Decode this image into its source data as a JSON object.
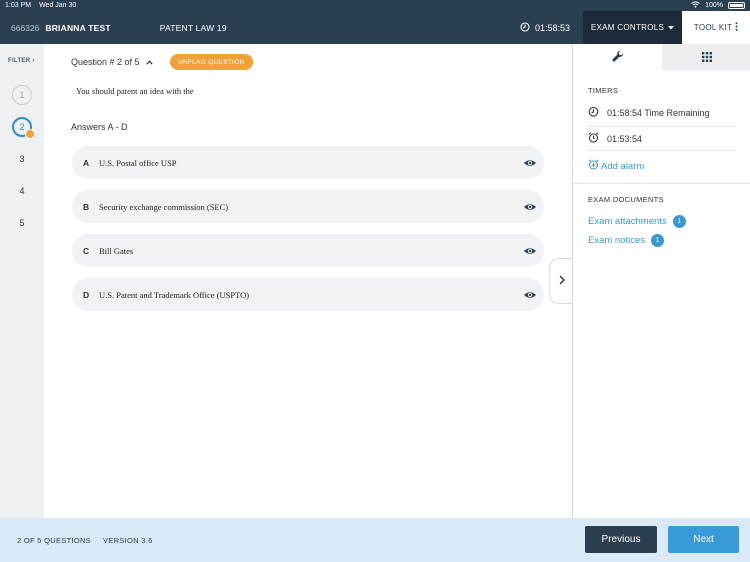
{
  "status_bar": {
    "time": "1:03 PM",
    "date": "Wed Jan 30",
    "battery": "100%"
  },
  "header": {
    "exam_id": "666326",
    "student_name": "BRIANNA TEST",
    "exam_name": "PATENT LAW 19",
    "timer": "01:58:53",
    "exam_controls_label": "EXAM CONTROLS",
    "toolkit_label": "TOOL KIT"
  },
  "qnav": {
    "filter_label": "FILTER",
    "questions": [
      "1",
      "2",
      "3",
      "4",
      "5"
    ]
  },
  "question": {
    "title": "Question # 2 of 5",
    "unflag_label": "UNFLAG QUESTION",
    "text": "You should patent an idea with the",
    "answers_label": "Answers A - D",
    "answers": [
      {
        "letter": "A",
        "text": "U.S. Postal office USP"
      },
      {
        "letter": "B",
        "text": "Security exchange commission (SEC)"
      },
      {
        "letter": "C",
        "text": "Bill Gates"
      },
      {
        "letter": "D",
        "text": "U.S. Patent and Trademark Office (USPTO)"
      }
    ]
  },
  "toolkit_panel": {
    "timers_heading": "TIMERS",
    "time_remaining": "01:58:54 Time Remaining",
    "alarm_time": "01:53:54",
    "add_alarm_label": "Add alarm",
    "docs_heading": "EXAM DOCUMENTS",
    "attachments_label": "Exam attachments",
    "attachments_count": "1",
    "notices_label": "Exam notices",
    "notices_count": "1"
  },
  "footer": {
    "progress": "2 OF 5 QUESTIONS",
    "version": "VERSION 3.6",
    "previous_label": "Previous",
    "next_label": "Next"
  }
}
